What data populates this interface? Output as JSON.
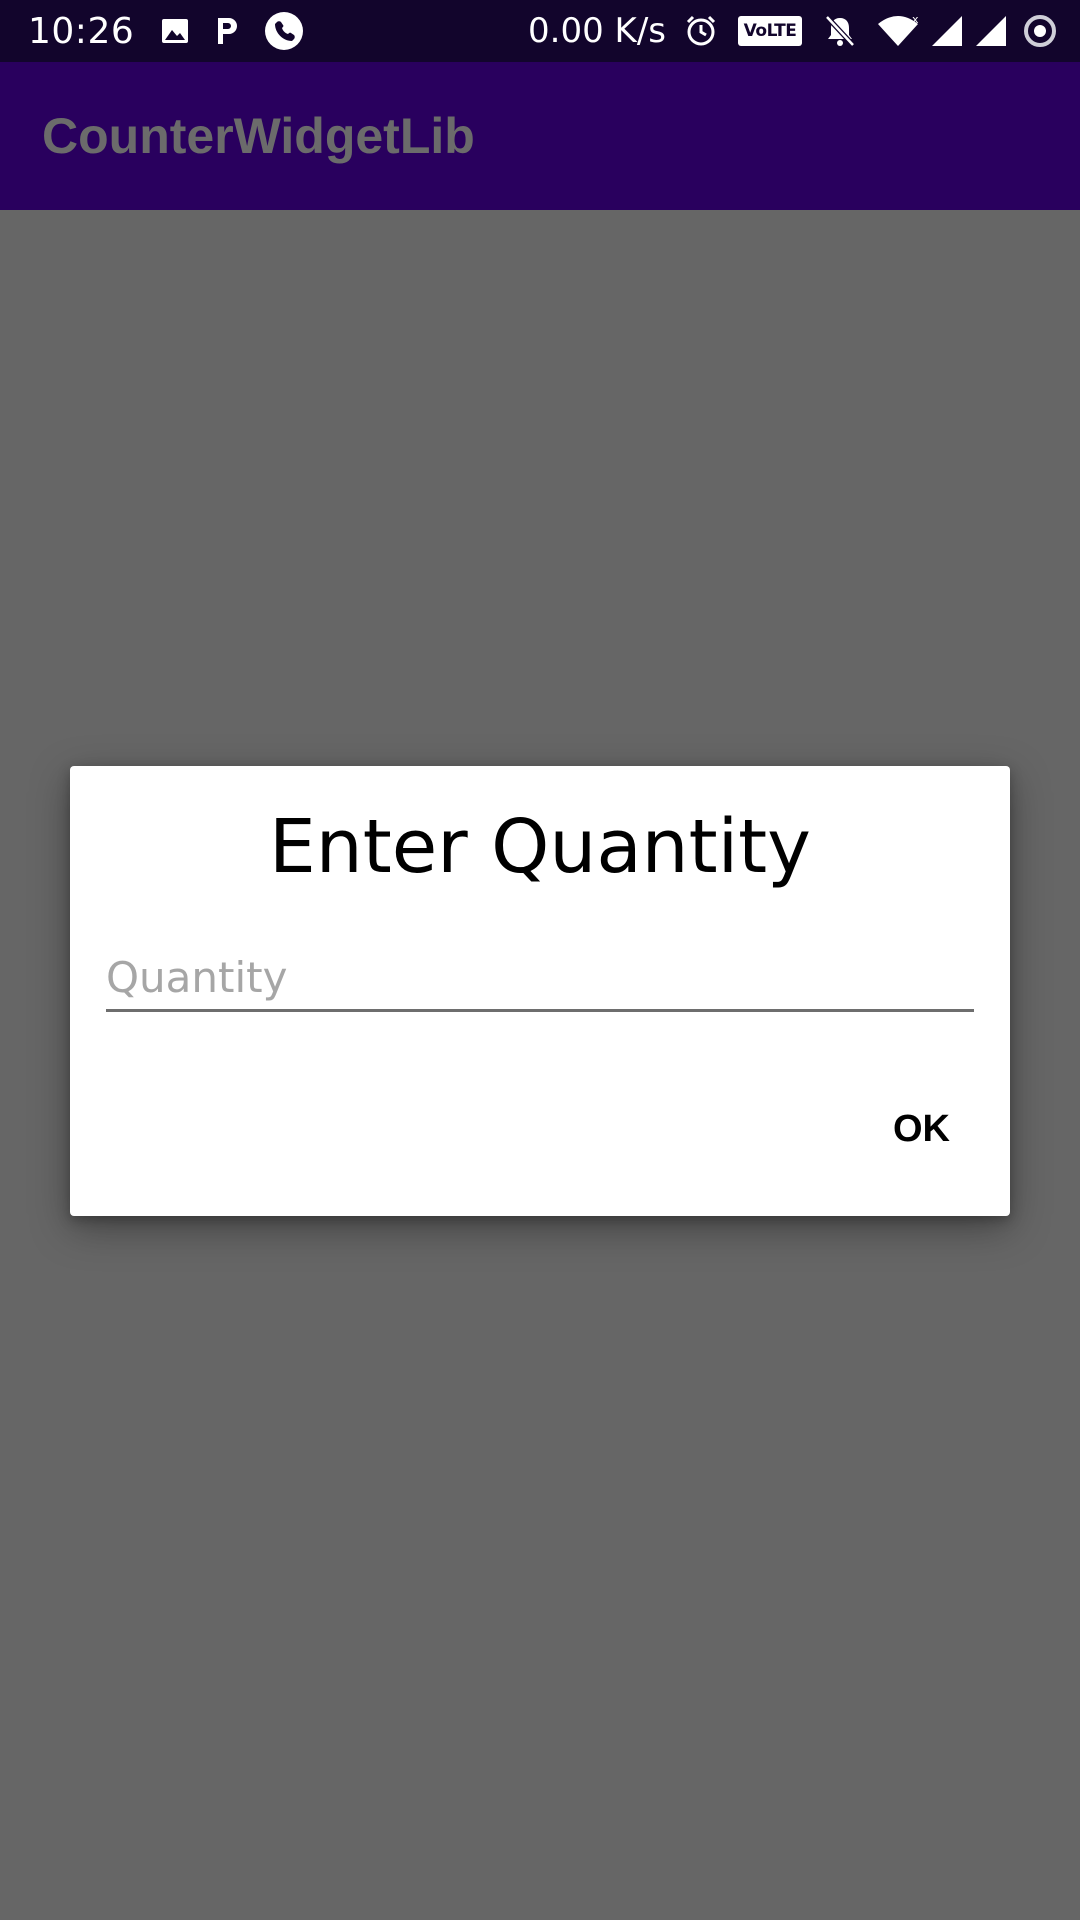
{
  "status_bar": {
    "time": "10:26",
    "network_speed": "0.00 K/s",
    "volte_label": "VoLTE",
    "left_icons": [
      "image-icon",
      "paytm-p-icon",
      "phone-call-icon"
    ],
    "right_icons": [
      "alarm-icon",
      "volte-icon",
      "notifications-off-icon",
      "wifi-icon",
      "signal-icon",
      "signal-icon",
      "sync-icon"
    ]
  },
  "app_bar": {
    "title": "CounterWidgetLib"
  },
  "dialog": {
    "title": "Enter Quantity",
    "input": {
      "placeholder": "Quantity",
      "value": ""
    },
    "ok_label": "OK"
  },
  "colors": {
    "status_bar": "#12052c",
    "app_bar_dimmed": "#29005e",
    "scrim_background": "#666666",
    "dialog_background": "#ffffff"
  }
}
